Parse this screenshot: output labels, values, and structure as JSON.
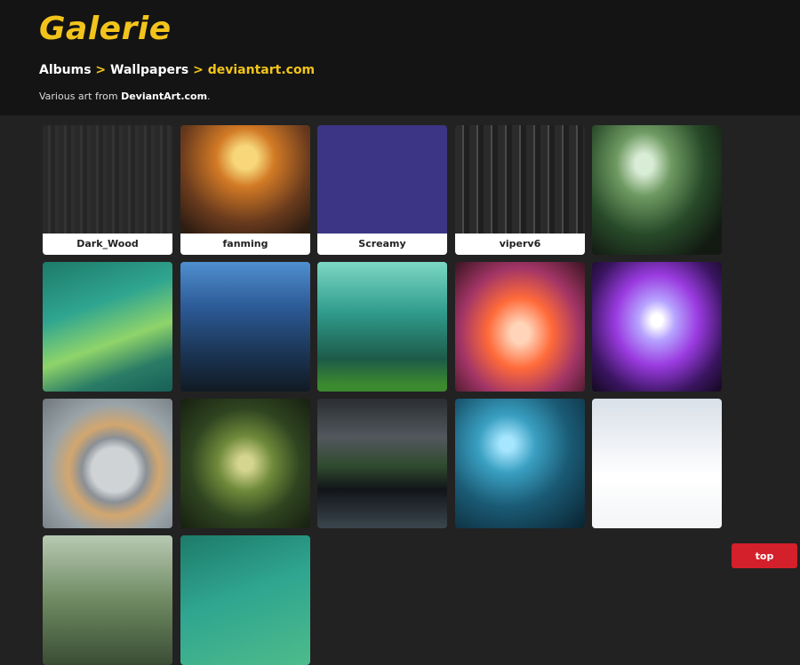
{
  "header": {
    "title": "Galerie",
    "breadcrumb": {
      "items": [
        "Albums",
        "Wallpapers"
      ],
      "separator": ">",
      "current": "deviantart.com"
    },
    "description_prefix": "Various art from ",
    "description_strong": "DeviantArt.com",
    "description_suffix": "."
  },
  "gallery": {
    "items": [
      {
        "caption": "Dark_Wood",
        "style": "t-darkwood"
      },
      {
        "caption": "fanming",
        "style": "t-fanming"
      },
      {
        "caption": "Screamy",
        "style": "t-screamy"
      },
      {
        "caption": "viperv6",
        "style": "t-viperv6"
      },
      {
        "caption": "",
        "style": "t-forest"
      },
      {
        "caption": "",
        "style": "t-vista"
      },
      {
        "caption": "",
        "style": "t-branch-blue"
      },
      {
        "caption": "",
        "style": "t-branch-green"
      },
      {
        "caption": "",
        "style": "t-blur-orange"
      },
      {
        "caption": "",
        "style": "t-blur-purple"
      },
      {
        "caption": "",
        "style": "t-halflife"
      },
      {
        "caption": "",
        "style": "t-dragon"
      },
      {
        "caption": "",
        "style": "t-lake"
      },
      {
        "caption": "",
        "style": "t-neuron"
      },
      {
        "caption": "",
        "style": "t-sheep"
      },
      {
        "caption": "",
        "style": "t-canyon"
      },
      {
        "caption": "",
        "style": "t-vista2"
      }
    ]
  },
  "top_button": {
    "label": "top"
  },
  "colors": {
    "accent": "#f2c41b",
    "header_bg": "#141414",
    "page_bg": "#222222",
    "top_button_bg": "#d4202a"
  }
}
